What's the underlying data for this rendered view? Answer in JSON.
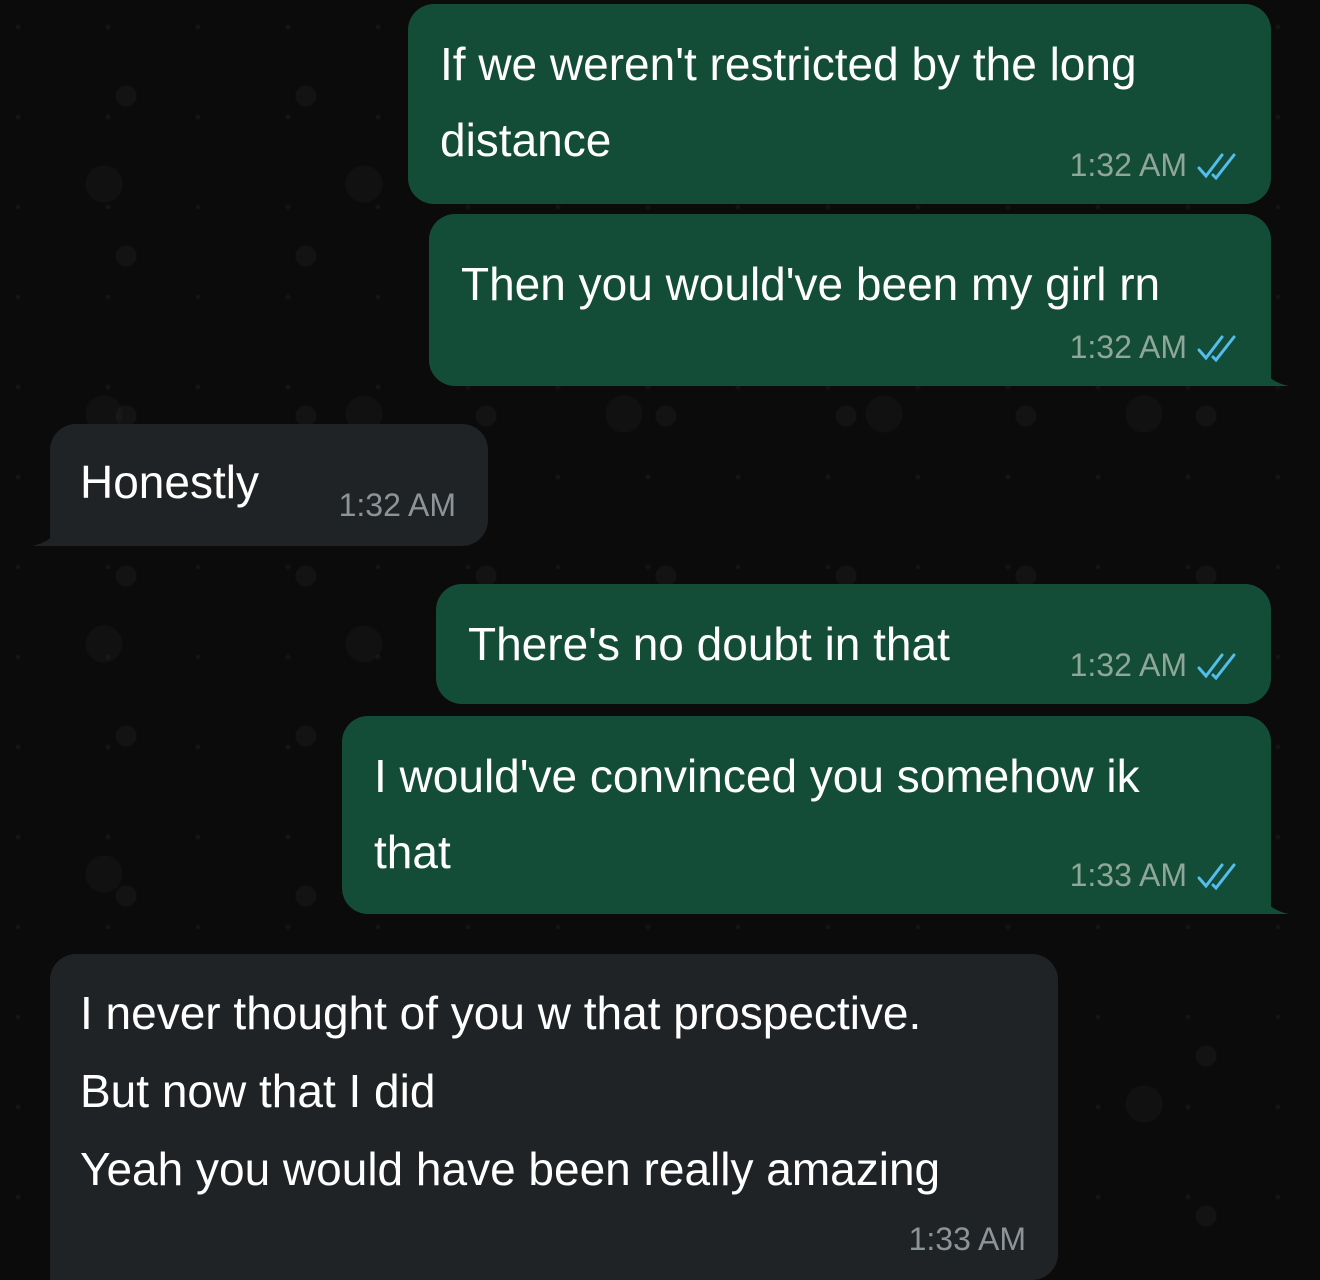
{
  "accent": {
    "outgoing_bubble": "#144d37",
    "incoming_bubble": "#202325",
    "read_ticks": "#53bdeb"
  },
  "messages": [
    {
      "text": "If we weren't restricted by the long\ndistance",
      "time": "1:32 AM",
      "direction": "outgoing",
      "status_icon": "double-check-read-icon"
    },
    {
      "text": "Then you would've been my girl rn",
      "time": "1:32 AM",
      "direction": "outgoing",
      "status_icon": "double-check-read-icon"
    },
    {
      "text": "Honestly",
      "time": "1:32 AM",
      "direction": "incoming"
    },
    {
      "text": "There's no doubt in that",
      "time": "1:32 AM",
      "direction": "outgoing",
      "status_icon": "double-check-read-icon"
    },
    {
      "text": "I would've convinced you somehow ik\nthat",
      "time": "1:33 AM",
      "direction": "outgoing",
      "status_icon": "double-check-read-icon"
    },
    {
      "text": "I never thought of you w that prospective.\nBut now that I did\nYeah you would have been really amazing",
      "time": "1:33 AM",
      "direction": "incoming"
    }
  ]
}
